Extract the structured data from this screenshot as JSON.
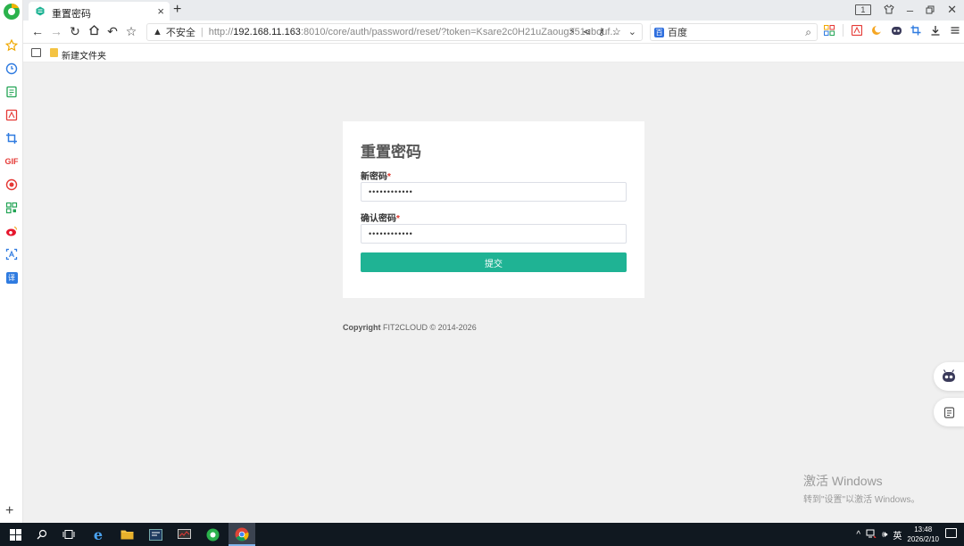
{
  "browser": {
    "tab": {
      "title": "重置密码"
    },
    "address": {
      "security_label": "不安全",
      "url_prefix": "http://",
      "url_host": "192.168.11.163",
      "url_rest": ":8010/core/auth/password/reset/?token=Ksare2c0H21uZaoug351ubouf..."
    },
    "search": {
      "engine_label": "百度"
    },
    "bookmarks": [
      {
        "label": "新建文件夹"
      }
    ],
    "tab_counter": "1"
  },
  "page": {
    "title": "重置密码",
    "new_password": {
      "label": "新密码",
      "required_mark": "*",
      "value": "••••••••••••"
    },
    "confirm_password": {
      "label": "确认密码",
      "required_mark": "*",
      "value": "••••••••••••"
    },
    "submit_label": "提交",
    "copyright_label": "Copyright",
    "copyright_text": "FIT2CLOUD © 2014-2026"
  },
  "watermark": {
    "line1": "激活 Windows",
    "line2": "转到\"设置\"以激活 Windows。"
  },
  "taskbar": {
    "time": "13:48",
    "date": "2026/2/10",
    "ime": "英"
  },
  "colors": {
    "accent": "#1fb394",
    "required": "#e0352b"
  }
}
